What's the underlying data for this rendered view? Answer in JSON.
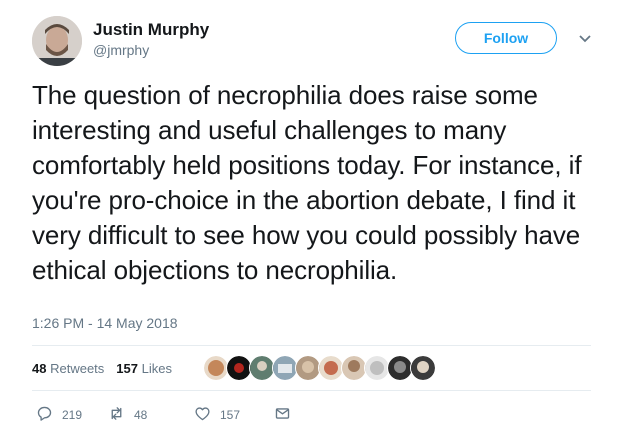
{
  "tweet": {
    "author_name": "Justin Murphy",
    "author_handle": "@jmrphy",
    "follow_label": "Follow",
    "text": "The question of necrophilia does raise some interesting and useful challenges to many comfortably held positions today. For instance, if you're pro-choice in the abortion debate, I find it very difficult to see how you could possibly have ethical objections to necrophilia.",
    "timestamp": "1:26 PM - 14 May 2018"
  },
  "stats": {
    "retweets_count": "48",
    "retweets_label": "Retweets",
    "likes_count": "157",
    "likes_label": "Likes"
  },
  "actions": {
    "replies": "219",
    "retweets": "48",
    "likes": "157"
  },
  "colors": {
    "accent": "#1da1f2",
    "text": "#14171a",
    "secondary": "#657786",
    "divider": "#e6ecf0"
  }
}
